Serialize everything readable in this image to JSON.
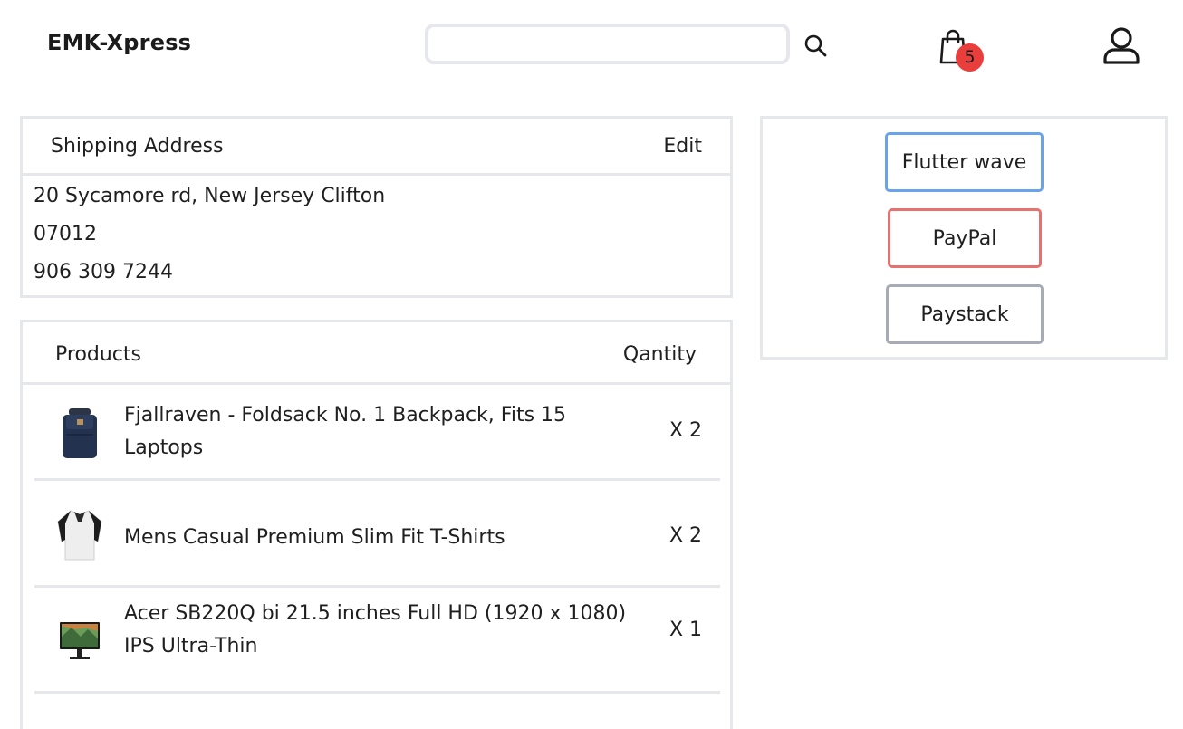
{
  "header": {
    "brand": "EMK-Xpress",
    "search_placeholder": "",
    "cart_count": "5"
  },
  "shipping": {
    "title": "Shipping Address",
    "edit_label": "Edit",
    "lines": [
      "20 Sycamore rd, New Jersey Clifton",
      "07012",
      "906 309 7244"
    ]
  },
  "products": {
    "title": "Products",
    "quantity_header": "Qantity",
    "items": [
      {
        "name": "Fjallraven - Foldsack No. 1 Backpack, Fits 15 Laptops",
        "qty": "X 2",
        "icon": "backpack-image"
      },
      {
        "name": "Mens Casual Premium Slim Fit T-Shirts",
        "qty": "X 2",
        "icon": "tshirt-image"
      },
      {
        "name": "Acer SB220Q bi 21.5 inches Full HD (1920 x 1080) IPS Ultra-Thin",
        "qty": "X 1",
        "icon": "monitor-image"
      }
    ]
  },
  "payment": {
    "options": [
      "Flutter wave",
      "PayPal",
      "Paystack"
    ]
  },
  "colors": {
    "badge": "#ea3e3c",
    "flutter_border": "#6aa3ea",
    "paypal_border": "#e67270",
    "paystack_border": "#a7abb5",
    "panel_border": "#e6e7ea"
  }
}
